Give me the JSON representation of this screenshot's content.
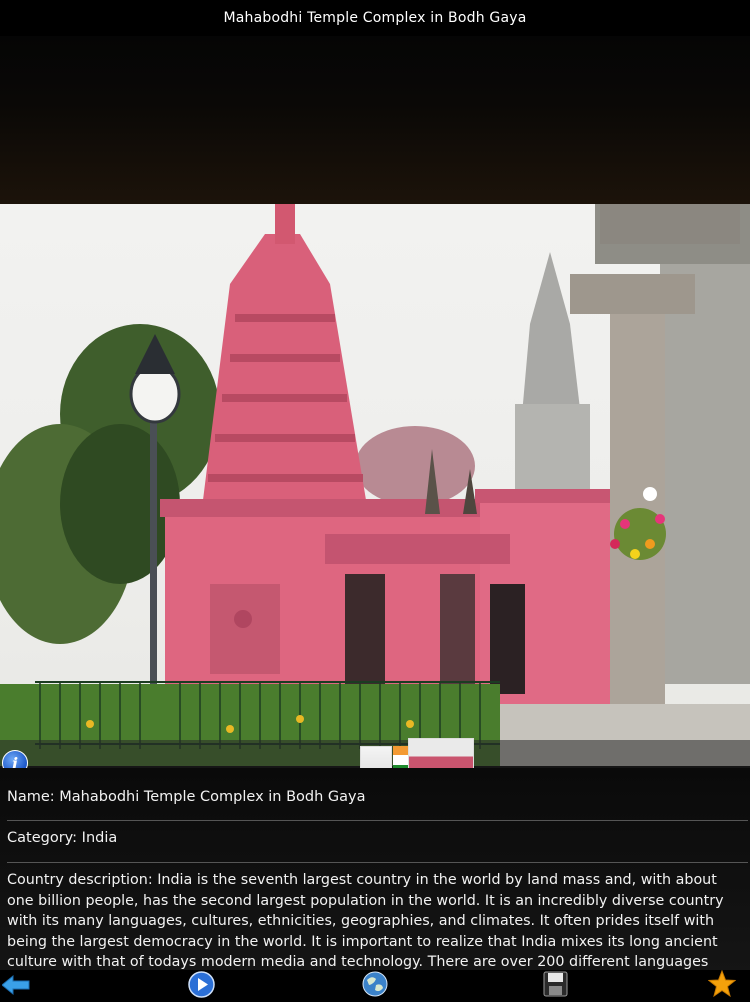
{
  "title": "Mahabodhi Temple Complex in Bodh Gaya",
  "details": {
    "name_label": "Name: Mahabodhi Temple Complex in Bodh Gaya",
    "category_label": "Category: India",
    "description": "Country description:  India is the seventh largest country in the world by land mass and, with about one billion people, has the second largest population in the world. It is an incredibly diverse country with its many languages, cultures, ethnicities, geographies, and climates. It often prides itself with being the largest democracy in the world. It is important to realize that India mixes its long ancient culture with that of todays modern media and technology. There are over 200 different languages"
  },
  "info_glyph": "i",
  "icons": {
    "info": "info-icon",
    "back": "back-arrow-icon",
    "play": "play-icon",
    "globe": "globe-icon",
    "save": "floppy-disk-icon",
    "favorite": "star-icon"
  },
  "colors": {
    "temple_pink": "#d9607a",
    "background": "#000000",
    "info_blue": "#1a55c8",
    "star": "#f4a10b"
  }
}
